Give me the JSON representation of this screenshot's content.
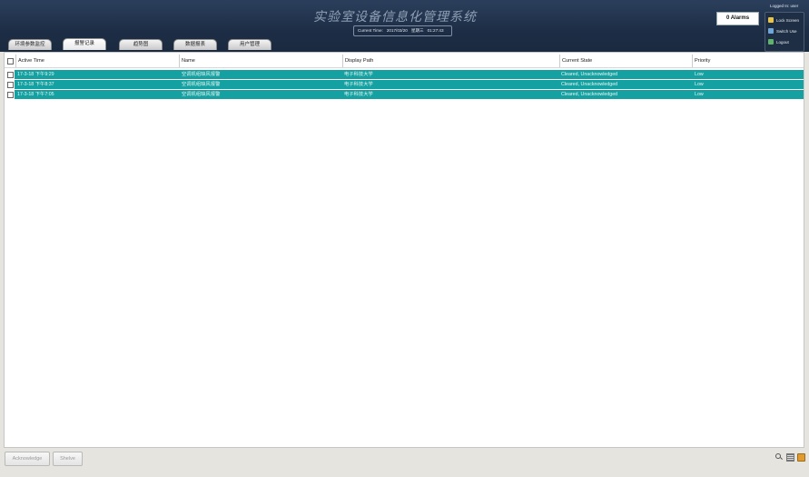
{
  "header": {
    "title": "实验室设备信息化管理系统",
    "clock_label": "Current Time:",
    "clock_date": "2017/03/20",
    "clock_weekday": "星期三",
    "clock_time": "01:27:43",
    "alarm_badge": "0 Alarms",
    "logged_in": "Logged In: user",
    "side_menu": [
      {
        "label": "Lock Screen",
        "icon": "lock-icon"
      },
      {
        "label": "Switch Use",
        "icon": "switch-user-icon"
      },
      {
        "label": "Logout",
        "icon": "logout-icon"
      }
    ]
  },
  "tabs": [
    {
      "label": "环境参数监控",
      "active": false
    },
    {
      "label": "报警记录",
      "active": true
    },
    {
      "label": "趋势图",
      "active": false
    },
    {
      "label": "数据报表",
      "active": false
    },
    {
      "label": "用户管理",
      "active": false
    }
  ],
  "table": {
    "columns": [
      "Active Time",
      "Name",
      "Display Path",
      "Current State",
      "Priority"
    ],
    "rows": [
      {
        "active_time": "17-3-18 下午9:29",
        "name": "空调机组缺风报警",
        "display_path": "电子科技大学",
        "current_state": "Cleared, Unacknowledged",
        "priority": "Low"
      },
      {
        "active_time": "17-3-18 下午8:37",
        "name": "空调机组缺风报警",
        "display_path": "电子科技大学",
        "current_state": "Cleared, Unacknowledged",
        "priority": "Low"
      },
      {
        "active_time": "17-3-18 下午7:05",
        "name": "空调机组缺风报警",
        "display_path": "电子科技大学",
        "current_state": "Cleared, Unacknowledged",
        "priority": "Low"
      }
    ],
    "row_color": "#15a1a1"
  },
  "footer": {
    "acknowledge_label": "Acknowledge",
    "shelve_label": "Shelve",
    "icons": [
      "search-icon",
      "table-icon",
      "export-icon"
    ]
  },
  "colors": {
    "header_bg": "#1d2d45",
    "accent": "#15a1a1"
  }
}
